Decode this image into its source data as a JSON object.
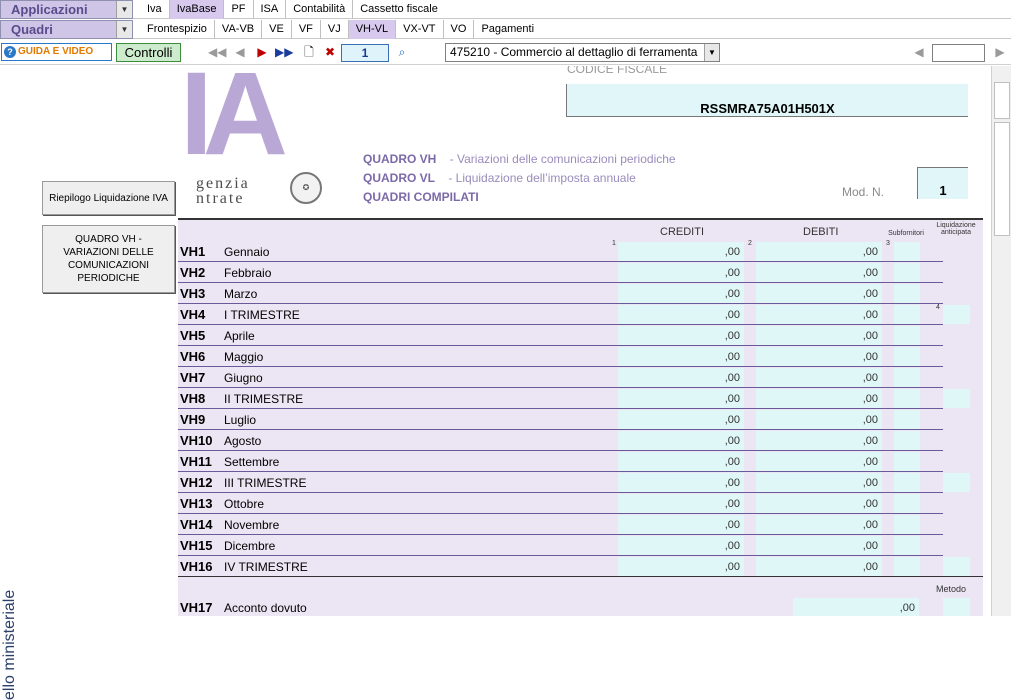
{
  "menu": {
    "app_dropdown": "Applicazioni",
    "quadri_dropdown": "Quadri",
    "top_tabs": [
      "Iva",
      "IvaBase",
      "PF",
      "ISA",
      "Contabilità",
      "Cassetto fiscale"
    ],
    "top_active": "IvaBase",
    "sub_tabs": [
      "Frontespizio",
      "VA-VB",
      "VE",
      "VF",
      "VJ",
      "VH-VL",
      "VX-VT",
      "VO",
      "Pagamenti"
    ],
    "sub_active": "VH-VL"
  },
  "toolbar": {
    "guida_label": "GUIDA E VIDEO",
    "controlli_label": "Controlli",
    "page_number": "1",
    "activity_select": "475210 - Commercio al dettaglio di ferramenta"
  },
  "sidebar": {
    "riepilogo_button": "Riepilogo Liquidazione IVA",
    "quadro_vh_button": "QUADRO VH - VARIAZIONI DELLE COMUNICAZIONI PERIODICHE",
    "vertical_label": "ello ministeriale"
  },
  "form": {
    "logo_ia": "IA",
    "agenzia_line1": "genzia",
    "agenzia_line2": "ntrate",
    "cf_label": "CODICE FISCALE",
    "codice_fiscale": "RSSMRA75A01H501X",
    "quadro_vh": "QUADRO VH",
    "quadro_vh_desc": "- Variazioni delle comunicazioni periodiche",
    "quadro_vl": "QUADRO VL",
    "quadro_vl_desc": "- Liquidazione dell’imposta annuale",
    "quadri_compilati": "QUADRI COMPILATI",
    "mod_n_label": "Mod. N.",
    "mod_n_value": "1",
    "col_crediti": "CREDITI",
    "col_debiti": "DEBITI",
    "col_subfornitori": "Subfornitori",
    "col_liquidazione": "Liquidazione anticipata",
    "col_metodo": "Metodo",
    "sup1": "1",
    "sup2": "2",
    "sup3": "3",
    "sup4": "4",
    "rows": [
      {
        "code": "VH1",
        "label": "Gennaio",
        "crediti": ",00",
        "debiti": ",00"
      },
      {
        "code": "VH2",
        "label": "Febbraio",
        "crediti": ",00",
        "debiti": ",00"
      },
      {
        "code": "VH3",
        "label": "Marzo",
        "crediti": ",00",
        "debiti": ",00"
      },
      {
        "code": "VH4",
        "label": "I TRIMESTRE",
        "crediti": ",00",
        "debiti": ",00"
      },
      {
        "code": "VH5",
        "label": "Aprile",
        "crediti": ",00",
        "debiti": ",00"
      },
      {
        "code": "VH6",
        "label": "Maggio",
        "crediti": ",00",
        "debiti": ",00"
      },
      {
        "code": "VH7",
        "label": "Giugno",
        "crediti": ",00",
        "debiti": ",00"
      },
      {
        "code": "VH8",
        "label": "II TRIMESTRE",
        "crediti": ",00",
        "debiti": ",00"
      },
      {
        "code": "VH9",
        "label": "Luglio",
        "crediti": ",00",
        "debiti": ",00"
      },
      {
        "code": "VH10",
        "label": "Agosto",
        "crediti": ",00",
        "debiti": ",00"
      },
      {
        "code": "VH11",
        "label": "Settembre",
        "crediti": ",00",
        "debiti": ",00"
      },
      {
        "code": "VH12",
        "label": "III TRIMESTRE",
        "crediti": ",00",
        "debiti": ",00"
      },
      {
        "code": "VH13",
        "label": "Ottobre",
        "crediti": ",00",
        "debiti": ",00"
      },
      {
        "code": "VH14",
        "label": "Novembre",
        "crediti": ",00",
        "debiti": ",00"
      },
      {
        "code": "VH15",
        "label": "Dicembre",
        "crediti": ",00",
        "debiti": ",00"
      },
      {
        "code": "VH16",
        "label": "IV TRIMESTRE",
        "crediti": ",00",
        "debiti": ",00"
      }
    ],
    "vh17_code": "VH17",
    "vh17_label": "Acconto dovuto",
    "vh17_value": ",00"
  },
  "colors": {
    "accent": "#d7c8ee",
    "field": "#e0f7f8",
    "table_bg": "#ece6f4"
  }
}
